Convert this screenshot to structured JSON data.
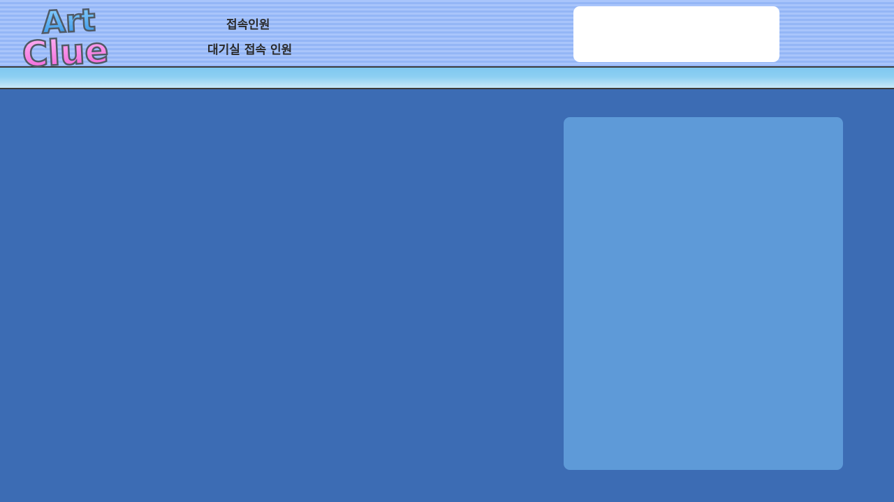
{
  "logo": {
    "line1": "Art",
    "line2": "Clue"
  },
  "stats": {
    "online_label": "접속인원",
    "waiting_label": "대기실 접속 인원"
  },
  "colors": {
    "header_stripe_light": "#a9c5fb",
    "header_stripe_dark": "#94b6f6",
    "main_background": "#3c6cb4",
    "side_panel": "#5e9ad8",
    "logo_top": "#4aa8f0",
    "logo_bottom": "#f47ee0"
  }
}
